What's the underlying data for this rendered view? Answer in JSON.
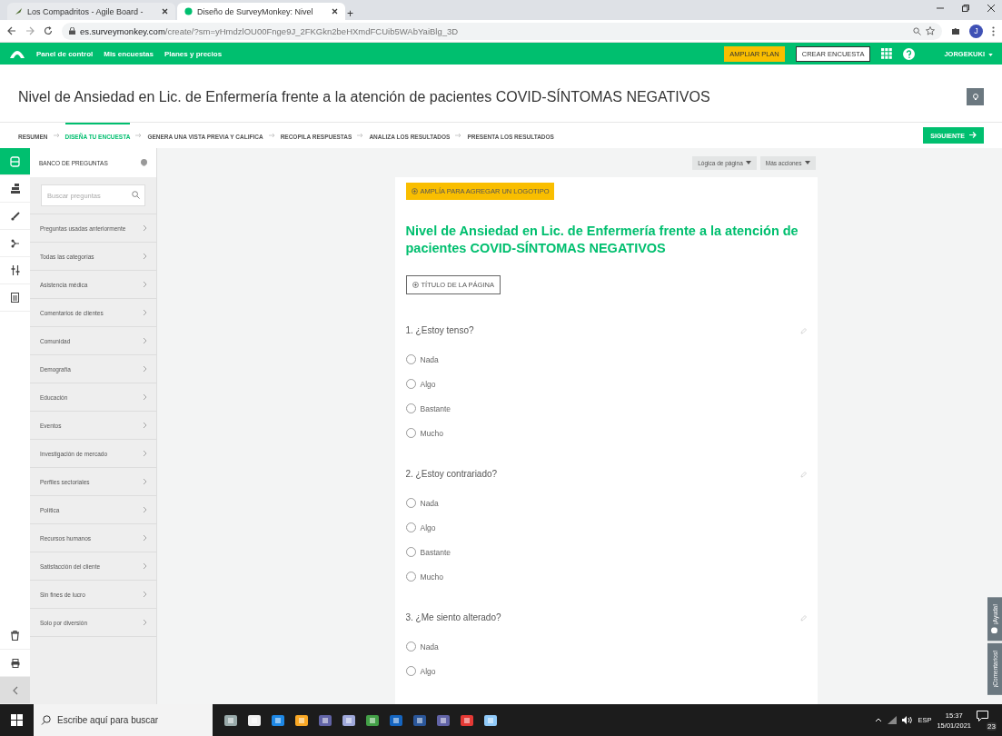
{
  "browser": {
    "tabs": [
      {
        "title": "Los Compadritos - Agile Board -",
        "selected": false
      },
      {
        "title": "Diseño de SurveyMonkey: Nivel",
        "selected": true
      }
    ],
    "new_tab": "+",
    "url": {
      "domain": "es.surveymonkey.com",
      "path": "/create/?sm=yHmdzlOU00Fnge9J_2FKGkn2beHXmdFCUib5WAbYaiBlg_3D"
    },
    "avatar": "J"
  },
  "nav": {
    "links": [
      "Panel de control",
      "Mis encuestas",
      "Planes y precios"
    ],
    "upgrade": "AMPLIAR PLAN",
    "create": "CREAR ENCUESTA",
    "user": "JORGEKUKI"
  },
  "survey_title": "Nivel de Ansiedad en Lic. de Enfermería frente a la atención de pacientes COVID-SÍNTOMAS NEGATIVOS",
  "steps": [
    {
      "label": "RESUMEN",
      "selected": false
    },
    {
      "label": "DISEÑA TU ENCUESTA",
      "selected": true
    },
    {
      "label": "GENERA UNA VISTA PREVIA Y CALIFICA",
      "selected": false
    },
    {
      "label": "RECOPILA RESPUESTAS",
      "selected": false
    },
    {
      "label": "ANALIZA LOS RESULTADOS",
      "selected": false
    },
    {
      "label": "PRESENTA LOS RESULTADOS",
      "selected": false
    }
  ],
  "next": "SIGUIENTE",
  "rail": [
    {
      "kind": "bank",
      "selected": true
    },
    {
      "kind": "builder",
      "selected": false
    },
    {
      "kind": "design",
      "selected": false
    },
    {
      "kind": "logic",
      "selected": false
    },
    {
      "kind": "options",
      "selected": false
    },
    {
      "kind": "print",
      "selected": false
    }
  ],
  "sidebar": {
    "title": "BANCO DE PREGUNTAS",
    "placeholder": "Buscar preguntas",
    "categories": [
      "Preguntas usadas anteriormente",
      "Todas las categorías",
      "Asistencia médica",
      "Comentarios de clientes",
      "Comunidad",
      "Demografía",
      "Educación",
      "Eventos",
      "Investigación de mercado",
      "Perfiles sectoriales",
      "Política",
      "Recursos humanos",
      "Satisfacción del cliente",
      "Sin fines de lucro",
      "Solo por diversión"
    ]
  },
  "page": {
    "actions": [
      "Lógica de página",
      "Más acciones"
    ],
    "logo_button": "AMPLÍA PARA AGREGAR UN LOGOTIPO",
    "title": "Nivel de Ansiedad en Lic. de Enfermería frente a la atención de pacientes COVID-SÍNTOMAS NEGATIVOS",
    "title_button": "TÍTULO DE LA PÁGINA",
    "questions": [
      {
        "text": "1. ¿Estoy tenso?",
        "options": [
          {
            "label": "Nada",
            "selected": false
          },
          {
            "label": "Algo",
            "selected": false
          },
          {
            "label": "Bastante",
            "selected": false
          },
          {
            "label": "Mucho",
            "selected": false
          }
        ]
      },
      {
        "text": "2. ¿Estoy contrariado?",
        "options": [
          {
            "label": "Nada",
            "selected": false
          },
          {
            "label": "Algo",
            "selected": false
          },
          {
            "label": "Bastante",
            "selected": false
          },
          {
            "label": "Mucho",
            "selected": false
          }
        ]
      },
      {
        "text": "3. ¿Me siento alterado?",
        "options": [
          {
            "label": "Nada",
            "selected": false
          },
          {
            "label": "Algo",
            "selected": false
          }
        ]
      }
    ]
  },
  "side_tabs": [
    "¡Ayuda!",
    "¡Comentarios!"
  ],
  "taskbar": {
    "placeholder": "Escribe aquí para buscar",
    "language": "ESP",
    "time": "15:37",
    "date": "15/01/2021",
    "notifications": "23"
  }
}
